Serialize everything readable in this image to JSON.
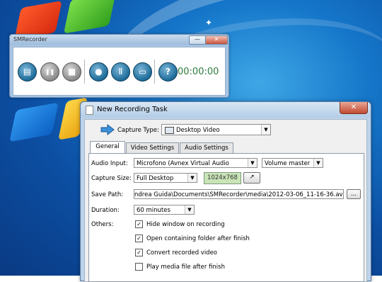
{
  "recorder": {
    "title": "SMRecorder",
    "minimize_glyph": "—",
    "close_glyph": "✕",
    "buttons": [
      {
        "name": "new-recording-icon",
        "glyph": "▤"
      },
      {
        "name": "pause-icon",
        "glyph": "❚❚"
      },
      {
        "name": "stop-icon",
        "glyph": "■"
      },
      {
        "name": "comment-icon",
        "glyph": "●"
      },
      {
        "name": "tools-icon",
        "glyph": "Ⅱ"
      },
      {
        "name": "folder-icon",
        "glyph": "▭"
      },
      {
        "name": "help-icon",
        "glyph": "?"
      }
    ],
    "timer": "00:00:00"
  },
  "dialog": {
    "title": "New Recording Task",
    "close_glyph": "✕",
    "capture_type_label": "Capture Type:",
    "capture_type_value": "Desktop Video",
    "tabs": [
      "General",
      "Video Settings",
      "Audio Settings"
    ],
    "general": {
      "audio_input_label": "Audio Input:",
      "audio_input_value": "Microfono (Avnex Virtual Audio",
      "volume_value": "Volume master",
      "capture_size_label": "Capture Size:",
      "capture_size_value": "Full Desktop",
      "resolution": "1024x768",
      "save_path_label": "Save Path:",
      "save_path_value": "ndrea Guida\\Documents\\SMRecorder\\media\\2012-03-06_11-16-36.avi",
      "browse_label": "...",
      "duration_label": "Duration:",
      "duration_value": "60 minutes",
      "others_label": "Others:",
      "options": [
        {
          "label": "Hide window on recording",
          "checked": true
        },
        {
          "label": "Open containing folder after finish",
          "checked": true
        },
        {
          "label": "Convert recorded video",
          "checked": true
        },
        {
          "label": "Play media file after finish",
          "checked": false
        }
      ]
    }
  },
  "colors": {
    "desktop": "#1576c9",
    "timer": "#2d7a3a",
    "button_blue": "#1d6c9a"
  }
}
